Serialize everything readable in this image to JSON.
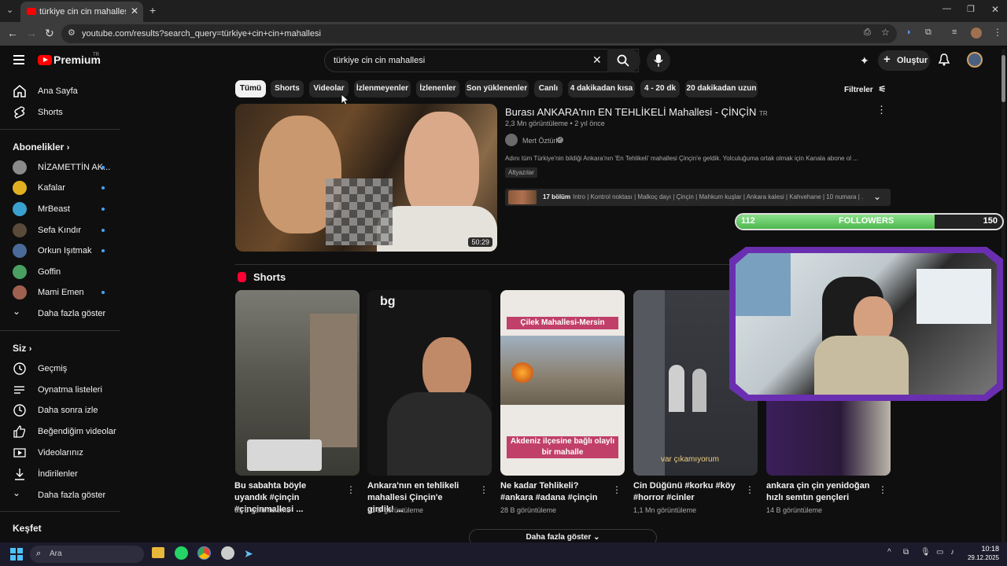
{
  "browser": {
    "tab_title": "türkiye cin cin mahallesi - YouTube",
    "url": "youtube.com/results?search_query=türkiye+cin+cin+mahallesi"
  },
  "header": {
    "logo_text": "Premium",
    "logo_region": "TR",
    "search_value": "türkiye cin cin mahallesi",
    "create_label": "Oluştur"
  },
  "sidebar": {
    "main": [
      {
        "label": "Ana Sayfa",
        "icon": "home-icon"
      },
      {
        "label": "Shorts",
        "icon": "shorts-icon"
      }
    ],
    "subs_title": "Abonelikler",
    "subs": [
      {
        "label": "NİZAMETTİN AK...",
        "color": "#8a8a8a"
      },
      {
        "label": "Kafalar",
        "color": "#e0b020"
      },
      {
        "label": "MrBeast",
        "color": "#3aa0d0"
      },
      {
        "label": "Sefa Kındır",
        "color": "#5a4a3a"
      },
      {
        "label": "Orkun Işıtmak",
        "color": "#4a6a9a"
      },
      {
        "label": "Goffin",
        "color": "#4aa060"
      },
      {
        "label": "Mami Emen",
        "color": "#a06050"
      }
    ],
    "subs_more": "Daha fazla göster",
    "you_title": "Siz",
    "you": [
      {
        "label": "Geçmiş",
        "icon": "history-icon"
      },
      {
        "label": "Oynatma listeleri",
        "icon": "playlist-icon"
      },
      {
        "label": "Daha sonra izle",
        "icon": "clock-icon"
      },
      {
        "label": "Beğendiğim videolar",
        "icon": "thumb-up-icon"
      },
      {
        "label": "Videolarınız",
        "icon": "video-icon"
      },
      {
        "label": "İndirilenler",
        "icon": "download-icon"
      },
      {
        "label": "Daha fazla göster",
        "icon": "chevron-down-icon"
      }
    ],
    "explore_title": "Keşfet"
  },
  "chips": [
    "Tümü",
    "Shorts",
    "Videolar",
    "İzlenmeyenler",
    "İzlenenler",
    "Son yüklenenler",
    "Canlı",
    "4 dakikadan kısa",
    "4 - 20 dk",
    "20 dakikadan uzun"
  ],
  "filters_label": "Filtreler",
  "video": {
    "title": "Burası ANKARA'nın EN TEHLİKELİ Mahallesi - ÇİNÇİN",
    "title_badge": "TR",
    "views": "2,3 Mn görüntüleme",
    "age": "2 yıl önce",
    "channel": "Mert Öztürk",
    "description": "Adını tüm Türkiye'nin bildiği Ankara'nın 'En Tehlikeli' mahallesi Çinçin'e geldik. Yolculuğuma ortak olmak için Kanala abone ol ...",
    "cc_badge": "Altyazılar",
    "chapters_count": "17 bölüm",
    "chapters_text": "Intro | Kontrol noktası | Malkoç dayı | Çinçin | Mahkum kuşlar | Ankara kalesi | Kahvehane | 10 numara | ...",
    "duration": "50:29"
  },
  "shorts_title": "Shorts",
  "shorts": [
    {
      "title": "Bu sabahta böyle uyandık #çinçin #çinçinmallesi ...",
      "views": "83 B görüntüleme",
      "bg": "#5a5a52"
    },
    {
      "title": "Ankara'nın en tehlikeli mahallesi Çinçin'e girdik! ...",
      "views": "21 B görüntüleme",
      "bg": "#1a1a1a",
      "logo": "bg"
    },
    {
      "title": "Ne kadar Tehlikeli? #ankara #adana #çinçin",
      "views": "28 B görüntüleme",
      "bg": "#e8e4df",
      "top_text": "Çilek Mahallesi-Mersin",
      "bottom_text": "Akdeniz ilçesine bağlı olaylı bir mahalle"
    },
    {
      "title": "Cin Düğünü  #korku #köy #horror #cinler",
      "views": "1,1 Mn görüntüleme",
      "bg": "#3c3e44",
      "bottom_text": "var çıkamıyorum"
    },
    {
      "title": "ankara çin çin yenidoğan hızlı semtın gençleri",
      "views": "14 B görüntüleme",
      "bg": "#3a2a4a"
    }
  ],
  "show_more": "Daha fazla göster",
  "overlay": {
    "followers_label": "FOLLOWERS",
    "followers_current": "112",
    "followers_goal": "150",
    "progress": 0.747
  },
  "taskbar": {
    "search": "Ara",
    "time": "10:18",
    "date": "29.12.2025"
  }
}
